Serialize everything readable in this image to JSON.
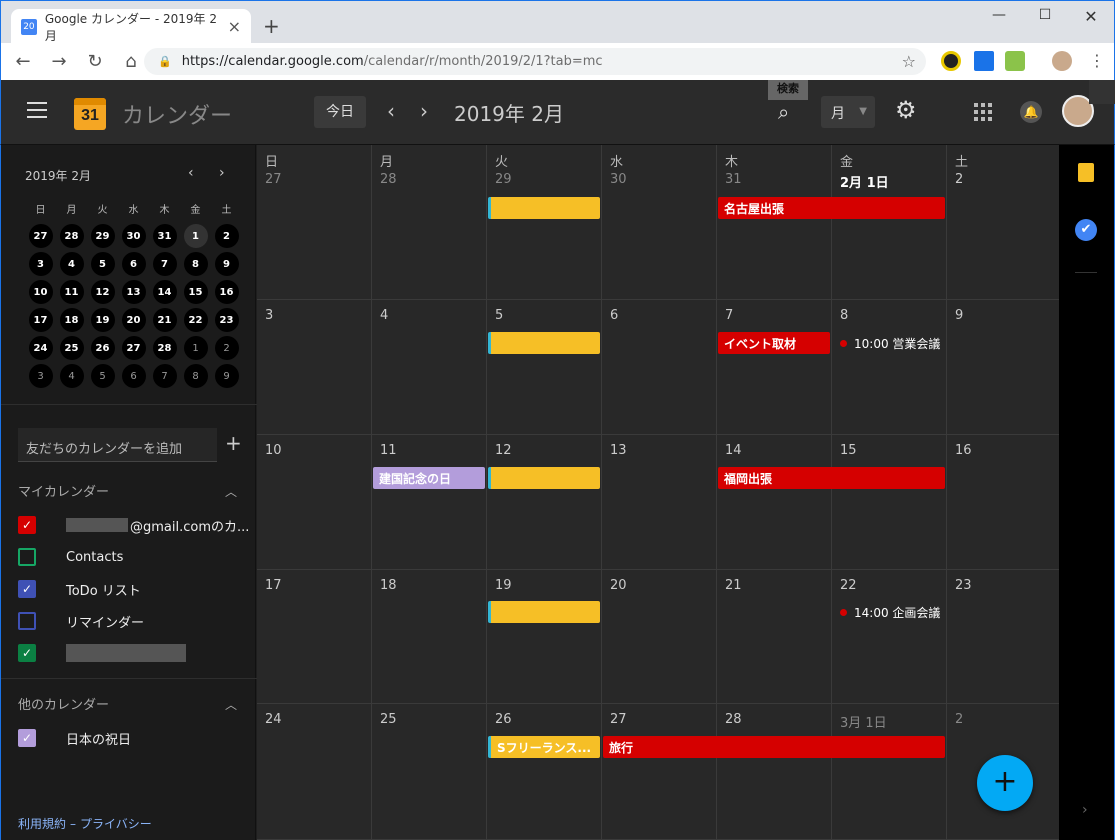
{
  "browser": {
    "tab_title": "Google カレンダー - 2019年 2月",
    "favicon_text": "20",
    "url_host": "https://calendar.google.com",
    "url_path": "/calendar/r/month/2019/2/1?tab=mc"
  },
  "header": {
    "app_name": "カレンダー",
    "logo_text": "31",
    "today_label": "今日",
    "current_month": "2019年 2月",
    "search_tooltip": "検索",
    "view_label": "月"
  },
  "mini_calendar": {
    "title": "2019年 2月",
    "weekdays": [
      "日",
      "月",
      "火",
      "水",
      "木",
      "金",
      "土"
    ],
    "days": [
      {
        "d": "27",
        "dim": false
      },
      {
        "d": "28",
        "dim": false
      },
      {
        "d": "29",
        "dim": false
      },
      {
        "d": "30",
        "dim": false
      },
      {
        "d": "31",
        "dim": false
      },
      {
        "d": "1",
        "dim": false,
        "today": true
      },
      {
        "d": "2",
        "dim": false
      },
      {
        "d": "3"
      },
      {
        "d": "4"
      },
      {
        "d": "5"
      },
      {
        "d": "6"
      },
      {
        "d": "7"
      },
      {
        "d": "8"
      },
      {
        "d": "9"
      },
      {
        "d": "10"
      },
      {
        "d": "11"
      },
      {
        "d": "12"
      },
      {
        "d": "13"
      },
      {
        "d": "14"
      },
      {
        "d": "15"
      },
      {
        "d": "16"
      },
      {
        "d": "17"
      },
      {
        "d": "18"
      },
      {
        "d": "19"
      },
      {
        "d": "20"
      },
      {
        "d": "21"
      },
      {
        "d": "22"
      },
      {
        "d": "23"
      },
      {
        "d": "24"
      },
      {
        "d": "25"
      },
      {
        "d": "26"
      },
      {
        "d": "27"
      },
      {
        "d": "28"
      },
      {
        "d": "1",
        "dim": true
      },
      {
        "d": "2",
        "dim": true
      },
      {
        "d": "3",
        "dim": true
      },
      {
        "d": "4",
        "dim": true
      },
      {
        "d": "5",
        "dim": true
      },
      {
        "d": "6",
        "dim": true
      },
      {
        "d": "7",
        "dim": true
      },
      {
        "d": "8",
        "dim": true
      },
      {
        "d": "9",
        "dim": true
      }
    ]
  },
  "sidebar": {
    "add_friend_placeholder": "友だちのカレンダーを追加",
    "my_calendars_title": "マイカレンダー",
    "my_calendars": [
      {
        "label": "@gmail.comのカ...",
        "color": "#d50000",
        "checked": true,
        "blurred": true
      },
      {
        "label": "Contacts",
        "color": "#16a765",
        "checked": false
      },
      {
        "label": "ToDo リスト",
        "color": "#3f51b5",
        "checked": true
      },
      {
        "label": "リマインダー",
        "color": "#3f51b5",
        "checked": false
      },
      {
        "label": "",
        "color": "#0b8043",
        "checked": true,
        "blurred_full": true
      }
    ],
    "other_calendars_title": "他のカレンダー",
    "other_calendars": [
      {
        "label": "日本の祝日",
        "color": "#b39ddb",
        "checked": true
      }
    ],
    "footer_terms": "利用規約",
    "footer_dash": "–",
    "footer_privacy": "プライバシー"
  },
  "grid": {
    "weekdays": [
      "日",
      "月",
      "火",
      "水",
      "木",
      "金",
      "土"
    ],
    "weeks": [
      [
        "27",
        "28",
        "29",
        "30",
        "31",
        "2月 1日",
        "2"
      ],
      [
        "3",
        "4",
        "5",
        "6",
        "7",
        "8",
        "9"
      ],
      [
        "10",
        "11",
        "12",
        "13",
        "14",
        "15",
        "16"
      ],
      [
        "17",
        "18",
        "19",
        "20",
        "21",
        "22",
        "23"
      ],
      [
        "24",
        "25",
        "26",
        "27",
        "28",
        "3月 1日",
        "2"
      ]
    ],
    "events": [
      {
        "week": 0,
        "col": 2,
        "span": 1,
        "label": "",
        "color": "yellow"
      },
      {
        "week": 0,
        "col": 4,
        "span": 2,
        "label": "名古屋出張",
        "color": "red"
      },
      {
        "week": 1,
        "col": 2,
        "span": 1,
        "label": "",
        "color": "yellow"
      },
      {
        "week": 1,
        "col": 4,
        "span": 1,
        "label": "イベント取材",
        "color": "red"
      },
      {
        "week": 2,
        "col": 1,
        "span": 1,
        "label": "建国記念の日",
        "color": "purple"
      },
      {
        "week": 2,
        "col": 2,
        "span": 1,
        "label": "",
        "color": "yellow"
      },
      {
        "week": 2,
        "col": 4,
        "span": 2,
        "label": "福岡出張",
        "color": "red"
      },
      {
        "week": 3,
        "col": 2,
        "span": 1,
        "label": "",
        "color": "yellow"
      },
      {
        "week": 4,
        "col": 2,
        "span": 1,
        "label": "Sフリーランス...",
        "color": "yellow"
      },
      {
        "week": 4,
        "col": 3,
        "span": 3,
        "label": "旅行",
        "color": "red"
      }
    ],
    "timed_events": [
      {
        "week": 1,
        "col": 5,
        "label": "10:00 営業会議"
      },
      {
        "week": 3,
        "col": 5,
        "label": "14:00 企画会議"
      }
    ]
  },
  "fab_label": "+"
}
